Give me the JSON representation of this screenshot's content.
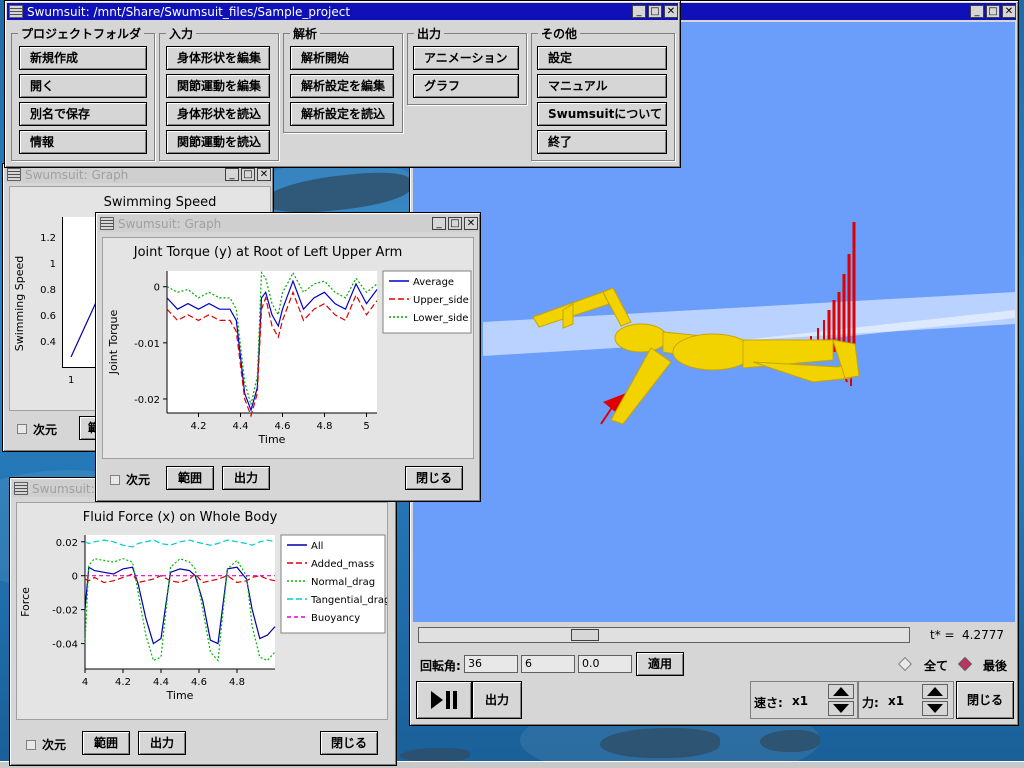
{
  "main_window": {
    "title": "Swumsuit: /mnt/Share/Swumsuit_files/Sample_project",
    "groups": {
      "project": {
        "label": "プロジェクトフォルダ",
        "buttons": [
          "新規作成",
          "開く",
          "別名で保存",
          "情報"
        ]
      },
      "input": {
        "label": "入力",
        "buttons": [
          "身体形状を編集",
          "関節運動を編集",
          "身体形状を読込",
          "関節運動を読込"
        ]
      },
      "analysis": {
        "label": "解析",
        "buttons": [
          "解析開始",
          "解析設定を編集",
          "解析設定を読込"
        ]
      },
      "output": {
        "label": "出力",
        "buttons": [
          "アニメーション",
          "グラフ"
        ]
      },
      "other": {
        "label": "その他",
        "buttons": [
          "設定",
          "マニュアル",
          "Swumsuitについて",
          "終了"
        ]
      }
    }
  },
  "graph_speed": {
    "title": "Swumsuit: Graph",
    "dim_label": "次元",
    "range_label": "範",
    "chart_data": {
      "type": "line",
      "title": "Swimming Speed",
      "ylabel": "Swimming Speed",
      "yticks": [
        "1.2",
        "1",
        "0.8",
        "0.6",
        "0.4"
      ],
      "xticks": [
        "1"
      ]
    }
  },
  "graph_torque": {
    "title": "Swumsuit: Graph",
    "dim_label": "次元",
    "range_label": "範囲",
    "output_label": "出力",
    "close_label": "閉じる",
    "chart_data": {
      "type": "line",
      "title": "Joint Torque (y) at Root of Left Upper Arm",
      "xlabel": "Time",
      "ylabel": "Joint Torque",
      "xlim": [
        4.05,
        5.05
      ],
      "ylim": [
        -0.0225,
        0.0028
      ],
      "xticks": [
        4.2,
        4.4,
        4.6,
        4.8,
        5
      ],
      "xtick_labels": [
        "4.2",
        "4.4",
        "4.6",
        "4.8",
        "5"
      ],
      "yticks": [
        0,
        -0.01,
        -0.02
      ],
      "ytick_labels": [
        "0",
        "-0.01",
        "-0.02"
      ],
      "legend_position": "right",
      "x": [
        4.05,
        4.1,
        4.15,
        4.2,
        4.25,
        4.3,
        4.35,
        4.38,
        4.42,
        4.45,
        4.48,
        4.5,
        4.52,
        4.55,
        4.58,
        4.6,
        4.63,
        4.65,
        4.7,
        4.75,
        4.8,
        4.85,
        4.9,
        4.95,
        5.0,
        5.05
      ],
      "series": [
        {
          "name": "Average",
          "color": "#0000cc",
          "dash": "",
          "values": [
            -0.002,
            -0.004,
            -0.003,
            -0.004,
            -0.003,
            -0.004,
            -0.004,
            -0.006,
            -0.019,
            -0.022,
            -0.018,
            -0.002,
            -0.001,
            -0.005,
            -0.007,
            -0.004,
            -0.001,
            0.001,
            -0.004,
            -0.002,
            -0.001,
            -0.003,
            -0.004,
            0.0005,
            -0.003,
            -0.0005
          ]
        },
        {
          "name": "Upper_side",
          "color": "#dd0000",
          "dash": "6,3",
          "values": [
            -0.004,
            -0.006,
            -0.005,
            -0.006,
            -0.005,
            -0.006,
            -0.006,
            -0.008,
            -0.02,
            -0.023,
            -0.019,
            -0.004,
            -0.002,
            -0.007,
            -0.009,
            -0.006,
            -0.003,
            -0.001,
            -0.006,
            -0.004,
            -0.003,
            -0.005,
            -0.006,
            -0.0015,
            -0.005,
            -0.0025
          ]
        },
        {
          "name": "Lower_side",
          "color": "#00aa00",
          "dash": "2,2",
          "values": [
            0.0,
            -0.001,
            -0.0005,
            -0.002,
            -0.001,
            -0.002,
            -0.002,
            -0.004,
            -0.017,
            -0.021,
            -0.016,
            0.0025,
            0.0015,
            -0.003,
            -0.005,
            -0.001,
            0.001,
            0.0025,
            -0.001,
            0.0005,
            0.001,
            -0.001,
            -0.002,
            0.0015,
            -0.001,
            0.0005
          ]
        }
      ]
    }
  },
  "graph_force": {
    "title": "Swumsuit: ",
    "dim_label": "次元",
    "range_label": "範囲",
    "output_label": "出力",
    "close_label": "閉じる",
    "chart_data": {
      "type": "line",
      "title": "Fluid Force (x) on Whole Body",
      "xlabel": "Time",
      "ylabel": "Force",
      "xlim": [
        4.0,
        5.0
      ],
      "ylim": [
        -0.055,
        0.024
      ],
      "xticks": [
        4.0,
        4.2,
        4.4,
        4.6,
        4.8
      ],
      "xtick_labels": [
        "4",
        "4.2",
        "4.4",
        "4.6",
        "4.8"
      ],
      "yticks": [
        0.02,
        0,
        -0.02,
        -0.04
      ],
      "ytick_labels": [
        "0.02",
        "0",
        "-0.02",
        "-0.04"
      ],
      "legend_position": "right",
      "x": [
        4.0,
        4.02,
        4.05,
        4.1,
        4.15,
        4.2,
        4.25,
        4.28,
        4.32,
        4.36,
        4.4,
        4.45,
        4.5,
        4.55,
        4.58,
        4.62,
        4.66,
        4.7,
        4.75,
        4.8,
        4.85,
        4.88,
        4.92,
        4.96,
        5.0
      ],
      "series": [
        {
          "name": "All",
          "color": "#0000aa",
          "dash": "",
          "values": [
            -0.02,
            0.005,
            0.003,
            0.002,
            0.001,
            0.004,
            0.005,
            -0.005,
            -0.025,
            -0.04,
            -0.037,
            0.002,
            0.004,
            0.003,
            0.0,
            -0.015,
            -0.038,
            -0.04,
            0.004,
            0.005,
            -0.002,
            -0.02,
            -0.037,
            -0.035,
            -0.03
          ]
        },
        {
          "name": "Added_mass",
          "color": "#dd0000",
          "dash": "6,3",
          "values": [
            -0.002,
            -0.003,
            -0.001,
            -0.004,
            -0.003,
            -0.001,
            0.001,
            -0.004,
            -0.003,
            -0.002,
            0.0,
            -0.003,
            -0.004,
            -0.002,
            0.001,
            -0.004,
            -0.003,
            -0.002,
            0.0,
            -0.004,
            -0.003,
            -0.001,
            0.0,
            -0.002,
            -0.003
          ]
        },
        {
          "name": "Normal_drag",
          "color": "#00bb00",
          "dash": "2,2",
          "values": [
            -0.04,
            0.006,
            0.01,
            0.009,
            0.008,
            0.01,
            0.008,
            -0.01,
            -0.035,
            -0.05,
            -0.048,
            0.005,
            0.01,
            0.008,
            0.004,
            -0.02,
            -0.045,
            -0.05,
            0.004,
            0.009,
            0.0,
            -0.03,
            -0.048,
            -0.05,
            -0.045
          ]
        },
        {
          "name": "Tangential_drag",
          "color": "#00cccc",
          "dash": "6,3",
          "values": [
            0.02,
            0.019,
            0.02,
            0.021,
            0.02,
            0.018,
            0.017,
            0.019,
            0.02,
            0.021,
            0.019,
            0.018,
            0.02,
            0.021,
            0.02,
            0.019,
            0.018,
            0.019,
            0.021,
            0.02,
            0.019,
            0.018,
            0.02,
            0.021,
            0.02
          ]
        },
        {
          "name": "Buoyancy",
          "color": "#dd00dd",
          "dash": "4,3",
          "values": [
            0.0,
            0.0,
            0.0,
            0.0,
            0.0,
            0.0,
            0.0,
            0.0,
            0.0,
            0.0,
            0.0,
            0.0,
            0.0,
            0.0,
            0.0,
            0.0,
            0.0,
            0.0,
            0.0,
            0.0,
            0.0,
            0.0,
            0.0,
            0.0,
            0.0
          ]
        }
      ]
    }
  },
  "animation_window": {
    "time_label": "t* =",
    "time_value": "4.2777",
    "slider_fraction": 0.33,
    "rotation_label": "回転角:",
    "rotation_values": [
      "36",
      "6",
      "0.0"
    ],
    "apply_label": "適用",
    "radio_all": "全て",
    "radio_last": "最後",
    "output_label": "出力",
    "speed_label": "速さ:",
    "speed_value": "x1",
    "force_label": "力:",
    "force_value": "x1",
    "close_label": "閉じる",
    "colors": {
      "background": "#6b9dfb",
      "body": "#f2d300",
      "force": "#e00000"
    }
  }
}
